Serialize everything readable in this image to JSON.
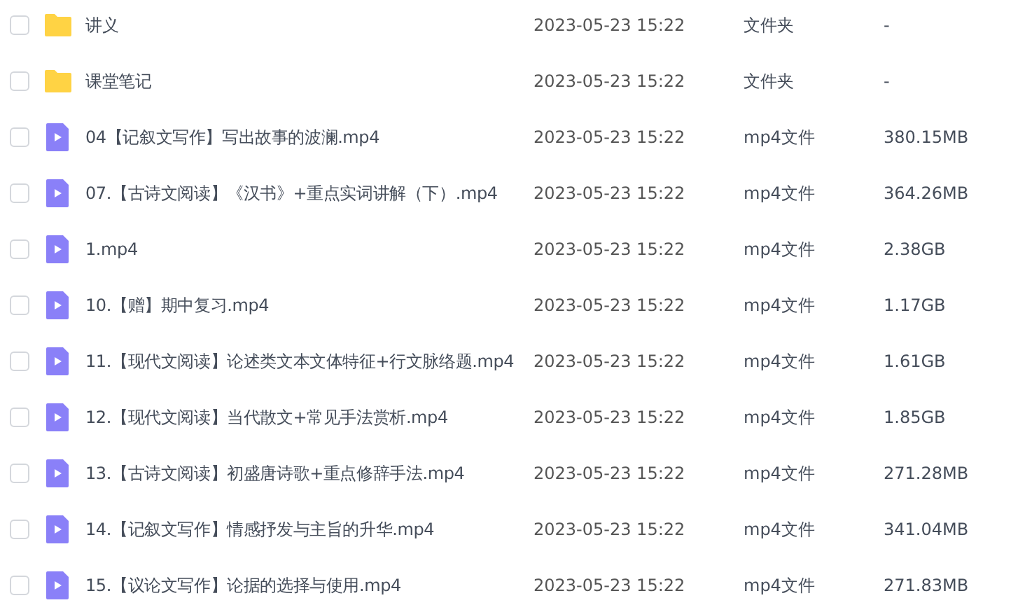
{
  "files": [
    {
      "kind": "folder",
      "checked": false,
      "name": "讲义",
      "modified": "2023-05-23 15:22",
      "type": "文件夹",
      "size": "-"
    },
    {
      "kind": "folder",
      "checked": false,
      "name": "课堂笔记",
      "modified": "2023-05-23 15:22",
      "type": "文件夹",
      "size": "-"
    },
    {
      "kind": "video",
      "checked": false,
      "name": "04【记叙文写作】写出故事的波澜.mp4",
      "modified": "2023-05-23 15:22",
      "type": "mp4文件",
      "size": "380.15MB"
    },
    {
      "kind": "video",
      "checked": false,
      "name": "07.【古诗文阅读】《汉书》+重点实词讲解（下）.mp4",
      "modified": "2023-05-23 15:22",
      "type": "mp4文件",
      "size": "364.26MB"
    },
    {
      "kind": "video",
      "checked": false,
      "name": "1.mp4",
      "modified": "2023-05-23 15:22",
      "type": "mp4文件",
      "size": "2.38GB"
    },
    {
      "kind": "video",
      "checked": false,
      "name": "10.【赠】期中复习.mp4",
      "modified": "2023-05-23 15:22",
      "type": "mp4文件",
      "size": "1.17GB"
    },
    {
      "kind": "video",
      "checked": false,
      "name": "11.【现代文阅读】论述类文本文体特征+行文脉络题.mp4",
      "modified": "2023-05-23 15:22",
      "type": "mp4文件",
      "size": "1.61GB"
    },
    {
      "kind": "video",
      "checked": false,
      "name": "12.【现代文阅读】当代散文+常见手法赏析.mp4",
      "modified": "2023-05-23 15:22",
      "type": "mp4文件",
      "size": "1.85GB"
    },
    {
      "kind": "video",
      "checked": false,
      "name": "13.【古诗文阅读】初盛唐诗歌+重点修辞手法.mp4",
      "modified": "2023-05-23 15:22",
      "type": "mp4文件",
      "size": "271.28MB"
    },
    {
      "kind": "video",
      "checked": false,
      "name": "14.【记叙文写作】情感抒发与主旨的升华.mp4",
      "modified": "2023-05-23 15:22",
      "type": "mp4文件",
      "size": "341.04MB"
    },
    {
      "kind": "video",
      "checked": false,
      "name": "15.【议论文写作】论据的选择与使用.mp4",
      "modified": "2023-05-23 15:22",
      "type": "mp4文件",
      "size": "271.83MB"
    }
  ]
}
